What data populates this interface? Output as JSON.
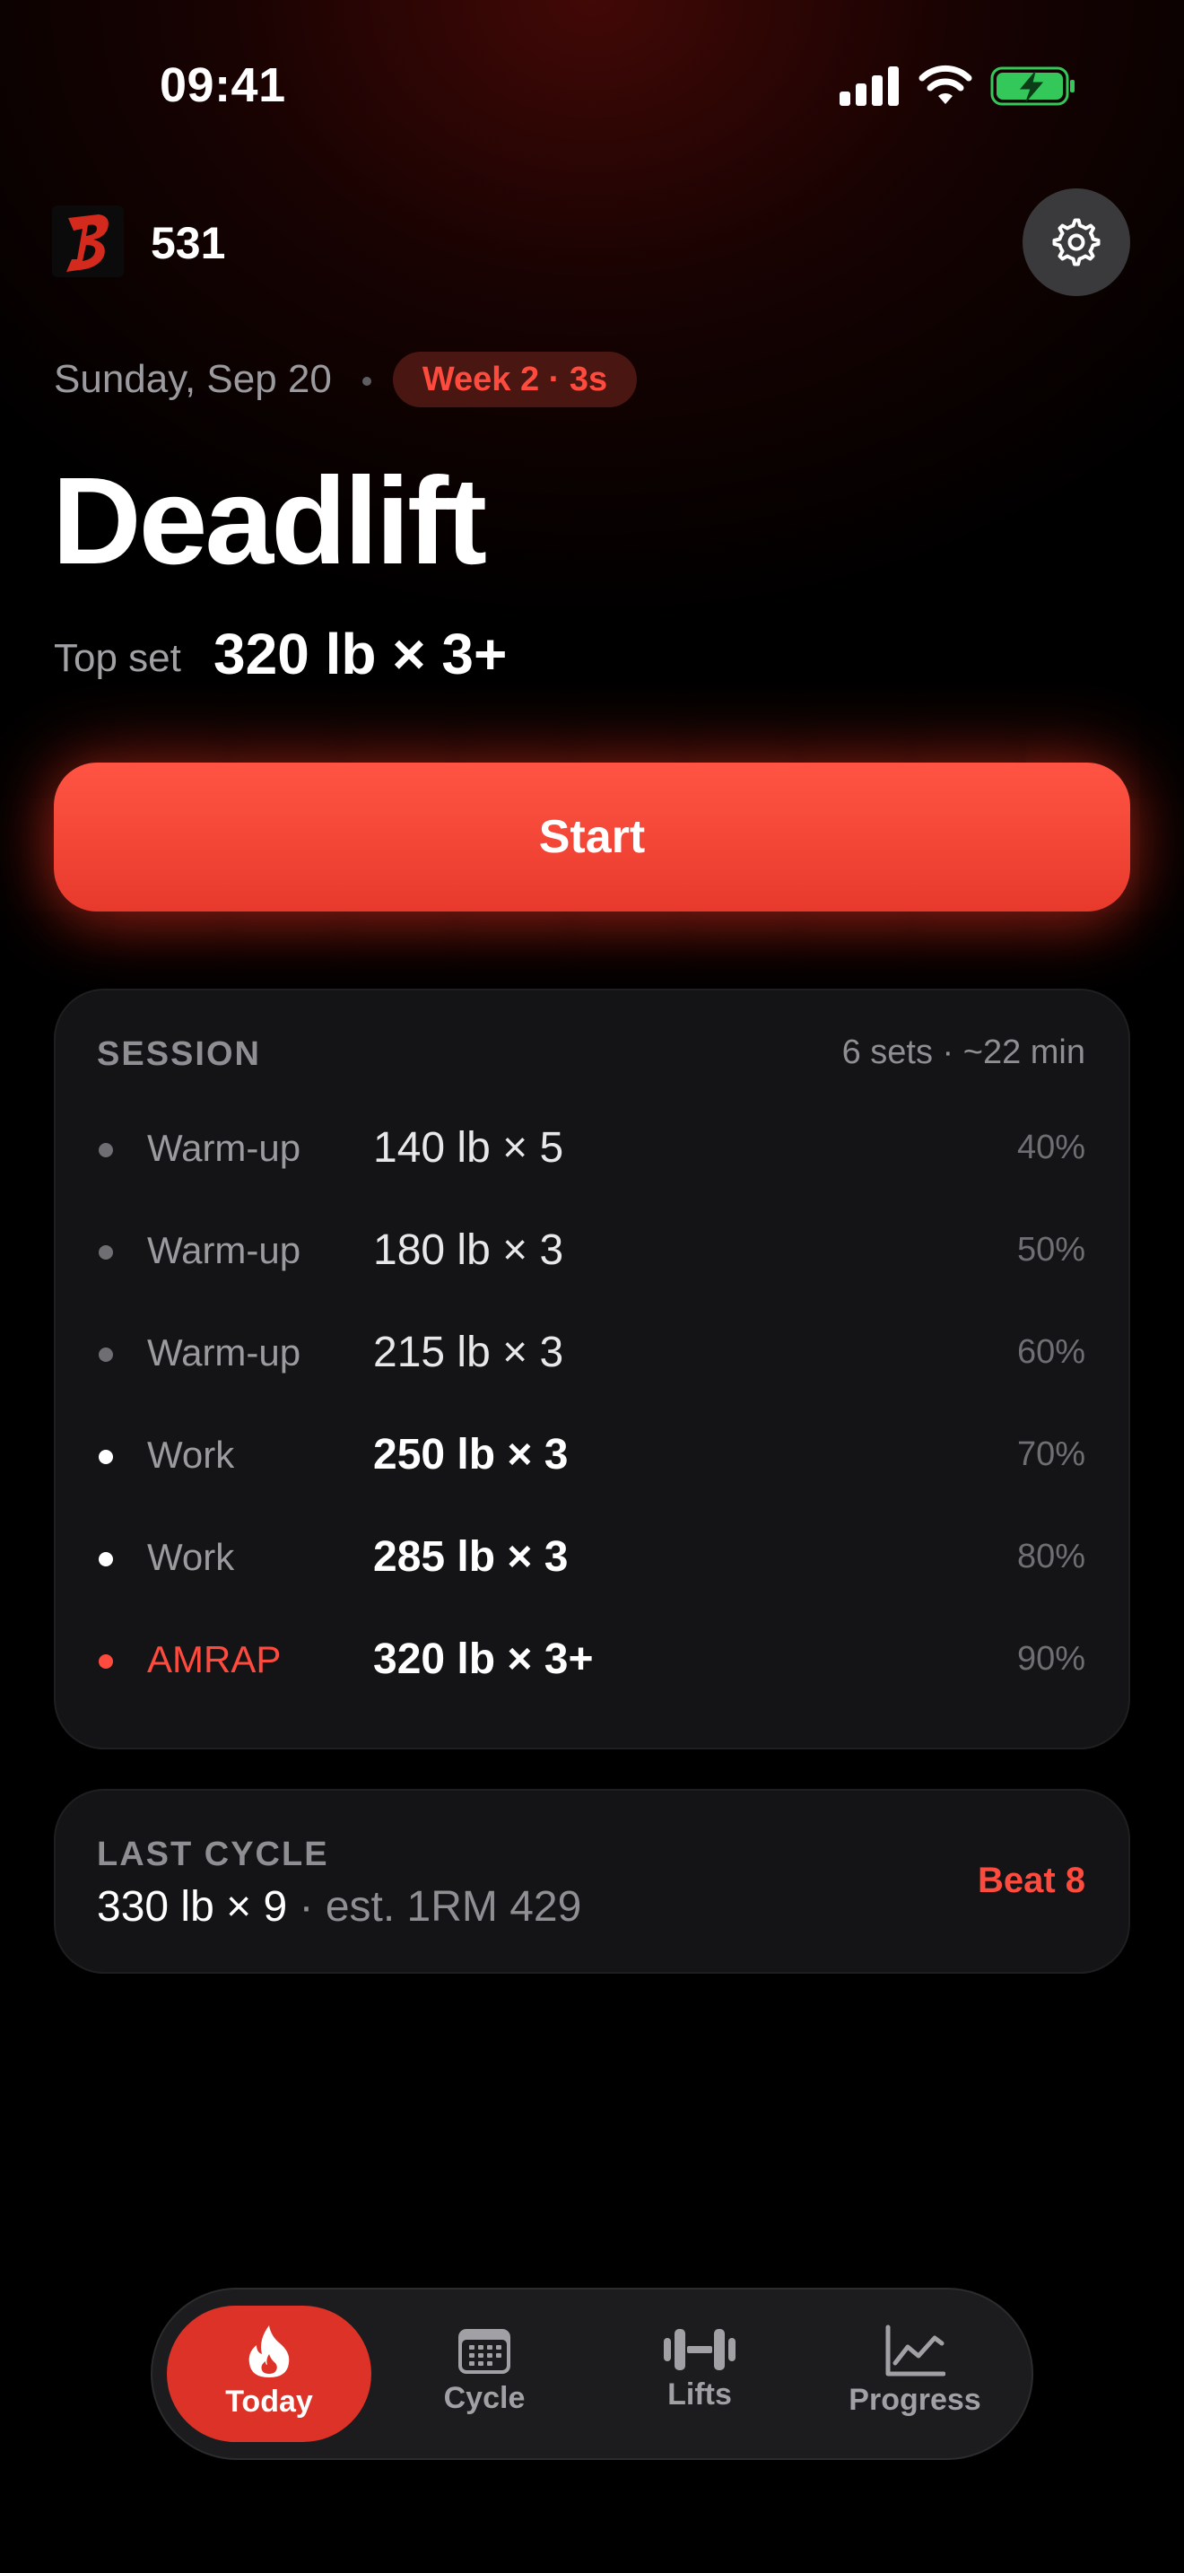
{
  "status_bar": {
    "time": "09:41"
  },
  "header": {
    "app_name": "531"
  },
  "today": {
    "date": "Sunday, Sep 20",
    "week_badge": "Week 2 · 3s",
    "lift": "Deadlift",
    "top_set_label": "Top set",
    "top_set_value": "320 lb × 3+",
    "start_label": "Start"
  },
  "session": {
    "heading": "SESSION",
    "meta": "6 sets · ~22 min",
    "sets": [
      {
        "type": "Warm-up",
        "load": "140 lb × 5",
        "pct": "40%"
      },
      {
        "type": "Warm-up",
        "load": "180 lb × 3",
        "pct": "50%"
      },
      {
        "type": "Warm-up",
        "load": "215 lb × 3",
        "pct": "60%"
      },
      {
        "type": "Work",
        "load": "250 lb × 3",
        "pct": "70%"
      },
      {
        "type": "Work",
        "load": "285 lb × 3",
        "pct": "80%"
      },
      {
        "type": "AMRAP",
        "load": "320 lb × 3+",
        "pct": "90%"
      }
    ]
  },
  "last_cycle": {
    "heading": "LAST CYCLE",
    "value": "330 lb × 9",
    "estimate": " · est. 1RM 429",
    "beat": "Beat 8"
  },
  "tabs": [
    {
      "label": "Today",
      "icon": "flame-icon"
    },
    {
      "label": "Cycle",
      "icon": "calendar-icon"
    },
    {
      "label": "Lifts",
      "icon": "dumbbell-icon"
    },
    {
      "label": "Progress",
      "icon": "chart-line-icon"
    }
  ],
  "colors": {
    "accent": "#ff4b3e",
    "start_button": "#ee4232",
    "card": "#141416",
    "background": "#000000"
  }
}
